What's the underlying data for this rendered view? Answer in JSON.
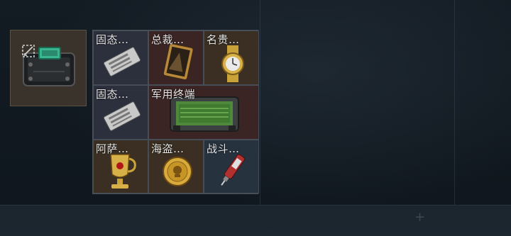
{
  "container": {
    "icon": "tactical-case-icon",
    "action_icon": "unequip-icon"
  },
  "items": [
    {
      "label": "固态…",
      "icon": "solid-state-drive-icon",
      "rarity_color": "#2c2f3c"
    },
    {
      "label": "总裁…",
      "icon": "president-card-icon",
      "rarity_color": "#3b2424"
    },
    {
      "label": "名贵…",
      "icon": "luxury-watch-icon",
      "rarity_color": "#3a2f22"
    },
    {
      "label": "固态…",
      "icon": "solid-state-drive-icon",
      "rarity_color": "#2c2f3c"
    },
    {
      "label": "军用终端",
      "icon": "military-terminal-icon",
      "rarity_color": "#3b2424"
    },
    {
      "label": "阿萨…",
      "icon": "golden-goblet-icon",
      "rarity_color": "#3a2f22"
    },
    {
      "label": "海盗…",
      "icon": "pirate-coin-icon",
      "rarity_color": "#3a2f22"
    },
    {
      "label": "战斗…",
      "icon": "combat-stim-icon",
      "rarity_color": "#27323f"
    }
  ]
}
